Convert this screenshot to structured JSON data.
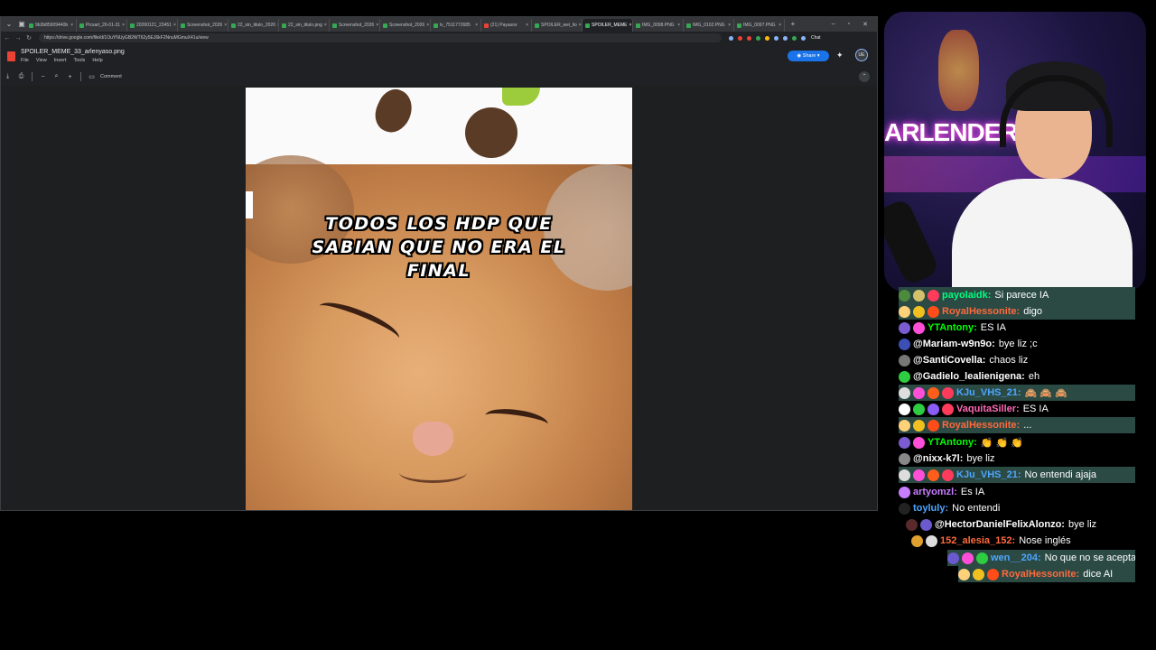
{
  "browser": {
    "tabs": [
      {
        "label": "9b3b85909440b"
      },
      {
        "label": "Picsart_26-01-31"
      },
      {
        "label": "20260121_23451"
      },
      {
        "label": "Screenshot_2026"
      },
      {
        "label": "22_sin_titulo_2026"
      },
      {
        "label": "22_sin_titulo.png"
      },
      {
        "label": "Screenshot_2026"
      },
      {
        "label": "Screenshot_2026"
      },
      {
        "label": "lv_7511772685"
      },
      {
        "label": "(21) Payasos"
      },
      {
        "label": "SPOILER_wei_lio"
      },
      {
        "label": "SPOILER_MEME"
      },
      {
        "label": "IMG_0098.PNG"
      },
      {
        "label": "IMG_0102.PNG"
      },
      {
        "label": "IMG_0097.PNG"
      }
    ],
    "active_tab_index": 11,
    "new_tab": "+",
    "url": "https://drive.google.com/file/d/1OuYNUyGB2WT62y5EJ6kF2NnuMGmuX41u/view",
    "chat_label": "Chat"
  },
  "viewer": {
    "file_name": "SPOILER_MEME_33_arlenyaso.png",
    "menus": [
      "File",
      "View",
      "Insert",
      "Tools",
      "Help"
    ],
    "share_label": "Share",
    "comment_label": "Comment",
    "account_initials": "UE",
    "meme_caption_1": "TODOS LOS HDP QUE",
    "meme_caption_2": "SABIAN QUE NO ERA EL",
    "meme_caption_3": "FINAL"
  },
  "webcam": {
    "neon_sign": "ARLENDER21"
  },
  "chat": {
    "messages": [
      {
        "user": "payolaidk:",
        "text": "Si parece IA",
        "color": "#00ff7f",
        "highlight": true,
        "badges": [
          "#4b8b3b",
          "#d4c06a",
          "#ff3b5c"
        ]
      },
      {
        "user": "RoyalHessonite:",
        "text": "digo",
        "color": "#ff6a3d",
        "highlight": true,
        "badges": [
          "#ffd27a",
          "#f0c020",
          "#ff4d1a"
        ]
      },
      {
        "user": "YTAntony:",
        "text": "ES IA",
        "color": "#00ff00",
        "highlight": false,
        "badges": [
          "#7a5bd1",
          "#ff4fd8"
        ]
      },
      {
        "user": "@Mariam-w9n9o:",
        "text": "bye liz ;c",
        "color": "#ffffff",
        "highlight": false,
        "badges": [
          "#3c4fb5"
        ]
      },
      {
        "user": "@SantiCovella:",
        "text": "chaos liz",
        "color": "#ffffff",
        "highlight": false,
        "badges": [
          "#777777"
        ]
      },
      {
        "user": "@Gadielo_lealienigena:",
        "text": "eh",
        "color": "#ffffff",
        "highlight": false,
        "badges": [
          "#2ecc40"
        ]
      },
      {
        "user": "KJu_VHS_21:",
        "text": "🙈 🙈 🙈",
        "color": "#4da6ff",
        "highlight": true,
        "badges": [
          "#dddddd",
          "#ff4fd8",
          "#ff5e1a",
          "#ff3b5c"
        ]
      },
      {
        "user": "VaquitaSiller:",
        "text": "ES IA",
        "color": "#ff69b4",
        "highlight": false,
        "badges": [
          "#ffffff",
          "#2ecc40",
          "#8b5cf6",
          "#ff3b5c"
        ]
      },
      {
        "user": "RoyalHessonite:",
        "text": "...",
        "color": "#ff6a3d",
        "highlight": true,
        "badges": [
          "#ffd27a",
          "#f0c020",
          "#ff4d1a"
        ]
      },
      {
        "user": "YTAntony:",
        "text": "👏 👏 👏",
        "color": "#00ff00",
        "highlight": false,
        "badges": [
          "#7a5bd1",
          "#ff4fd8"
        ]
      },
      {
        "user": "@nixx-k7l:",
        "text": "bye liz",
        "color": "#ffffff",
        "highlight": false,
        "badges": [
          "#888888"
        ]
      },
      {
        "user": "KJu_VHS_21:",
        "text": "No entendi ajaja",
        "color": "#4da6ff",
        "highlight": true,
        "badges": [
          "#dddddd",
          "#ff4fd8",
          "#ff5e1a",
          "#ff3b5c"
        ]
      },
      {
        "user": "artyomzl:",
        "text": "Es IA",
        "color": "#c77dff",
        "highlight": false,
        "badges": [
          "#c77dff"
        ]
      },
      {
        "user": "toyluly:",
        "text": "No entendi",
        "color": "#4da6ff",
        "highlight": false,
        "badges": [
          "#222222"
        ]
      },
      {
        "user": "@HectorDanielFelixAlonzo:",
        "text": "bye liz",
        "color": "#ffffff",
        "highlight": false,
        "badges": [
          "#5a2a2a",
          "#6a5acd"
        ]
      },
      {
        "user": "152_alesia_152:",
        "text": "Nose inglés",
        "color": "#ff6a3d",
        "highlight": false,
        "badges": [
          "#e0a030",
          "#dddddd"
        ]
      },
      {
        "user": "wen__204:",
        "text": "No que no se acepta",
        "color": "#4da6ff",
        "highlight": true,
        "badges": [
          "#6a5acd",
          "#ff4fd8",
          "#2ecc40"
        ]
      },
      {
        "user": "RoyalHessonite:",
        "text": "dice AI",
        "color": "#ff6a3d",
        "highlight": true,
        "badges": [
          "#ffd27a",
          "#f0c020",
          "#ff4d1a"
        ]
      }
    ]
  }
}
